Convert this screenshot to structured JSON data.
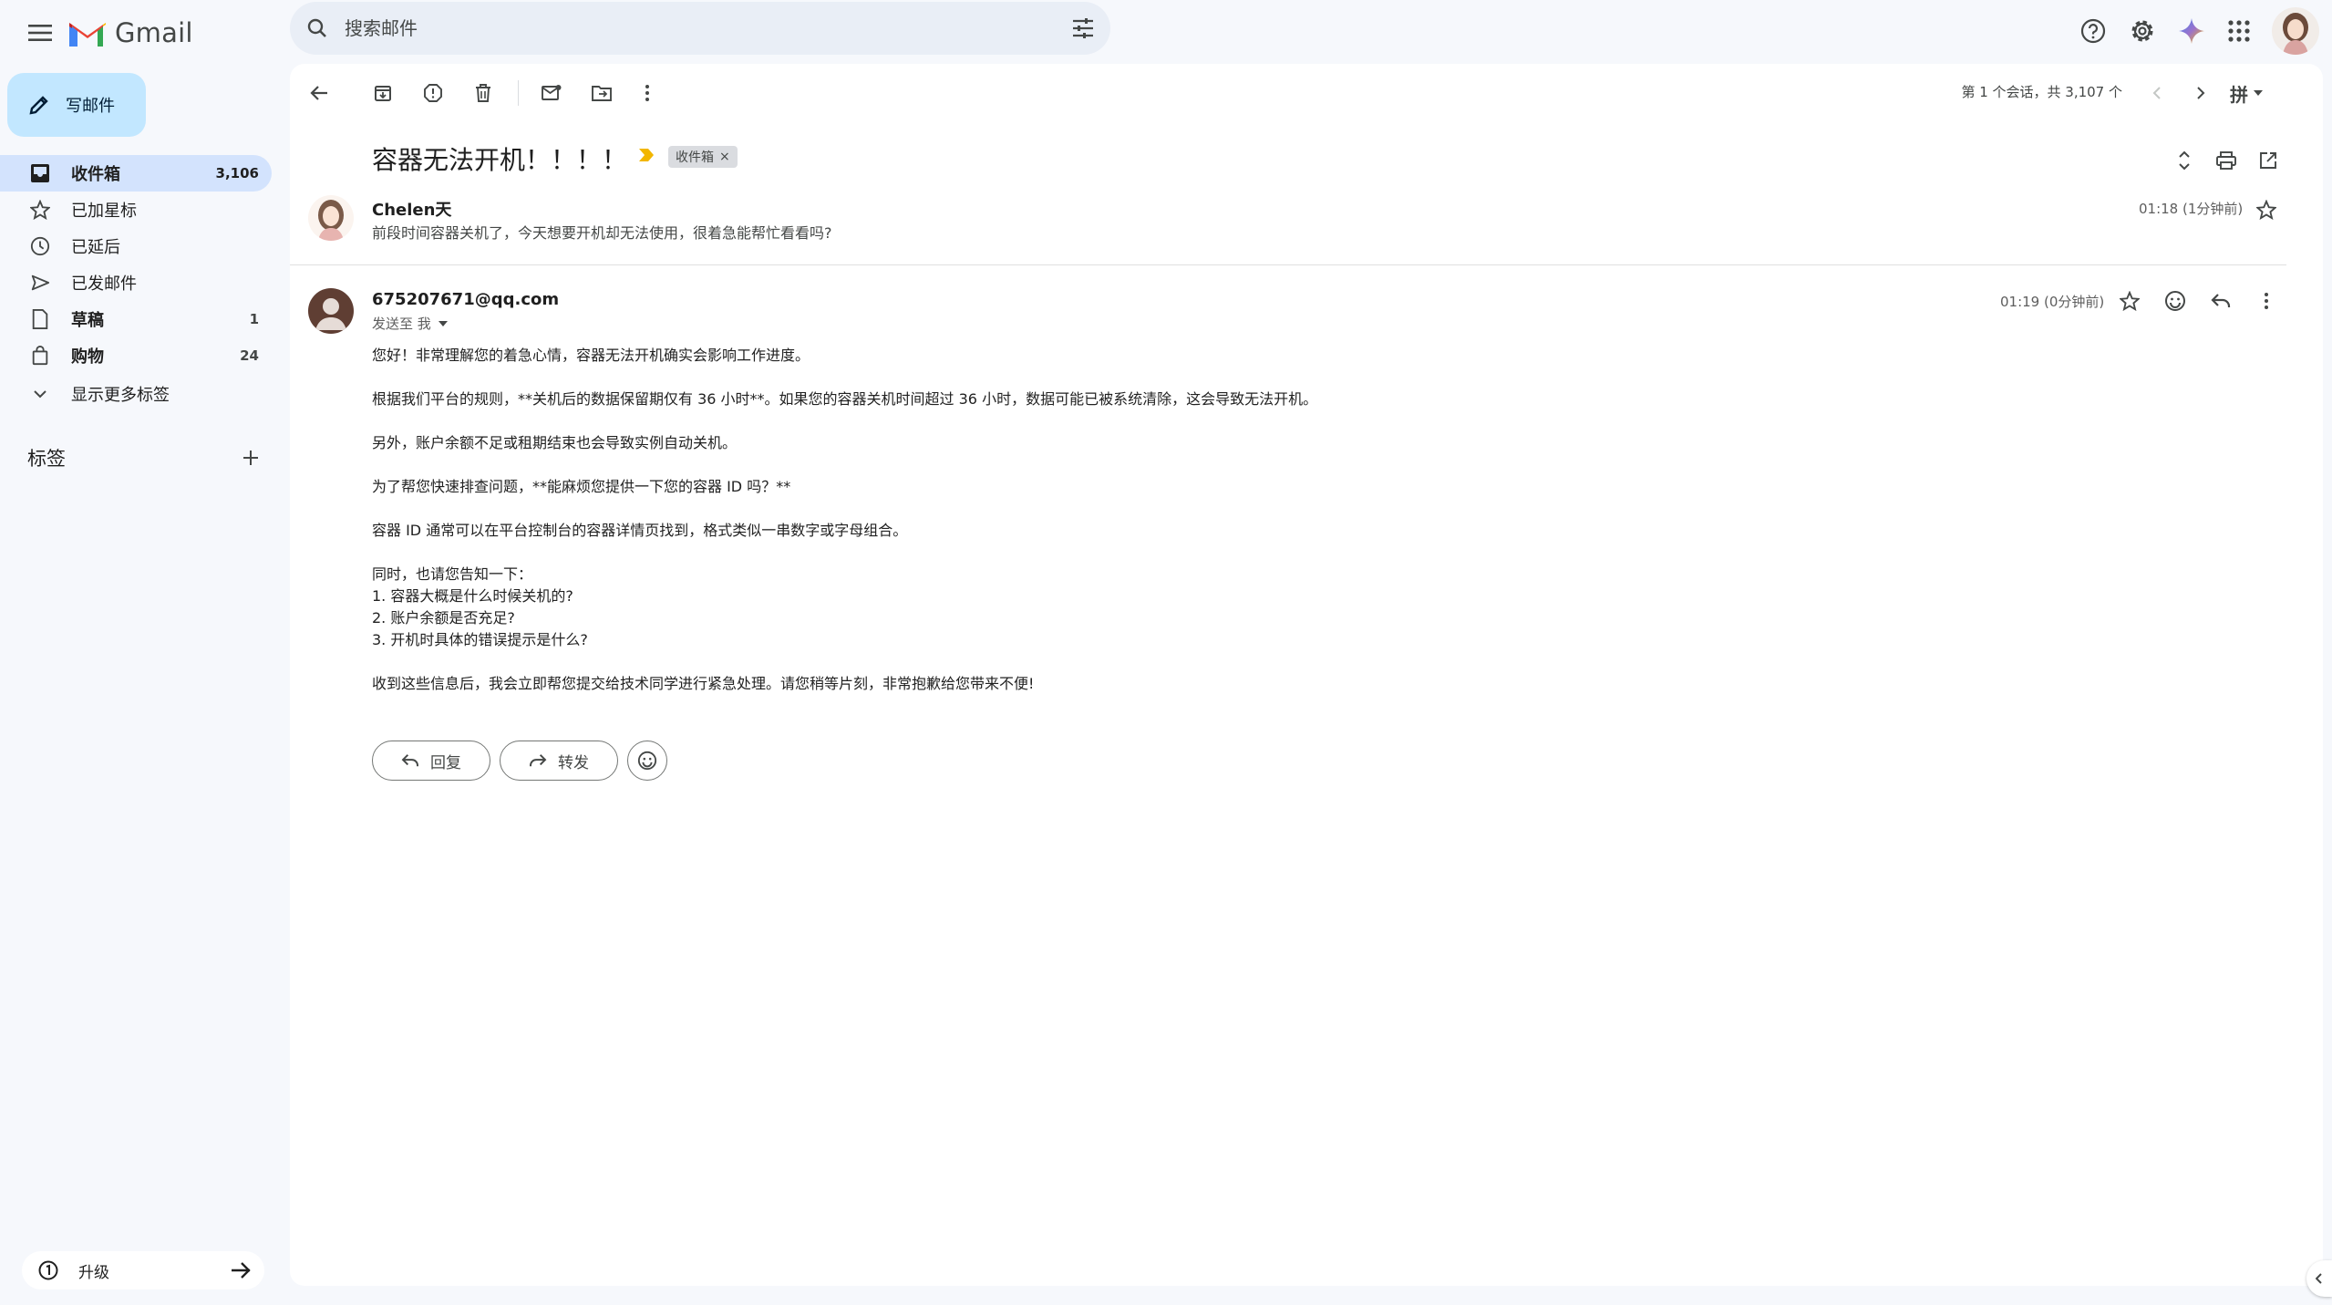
{
  "app": {
    "name": "Gmail"
  },
  "search": {
    "placeholder": "搜索邮件"
  },
  "sidebar": {
    "compose_label": "写邮件",
    "items": [
      {
        "label": "收件箱",
        "count": "3,106"
      },
      {
        "label": "已加星标",
        "count": ""
      },
      {
        "label": "已延后",
        "count": ""
      },
      {
        "label": "已发邮件",
        "count": ""
      },
      {
        "label": "草稿",
        "count": "1"
      },
      {
        "label": "购物",
        "count": "24"
      },
      {
        "label": "显示更多标签",
        "count": ""
      }
    ],
    "labels_heading": "标签",
    "upgrade_label": "升级"
  },
  "toolbar": {
    "pager_text": "第 1 个会话，共 3,107 个"
  },
  "thread": {
    "subject": "容器无法开机！！！！",
    "tag": "收件箱",
    "collapsed_message": {
      "sender": "Chelen天",
      "snippet": "前段时间容器关机了，今天想要开机却无法使用，很着急能帮忙看看吗?",
      "time": "01:18 (1分钟前)"
    },
    "message": {
      "sender": "675207671@qq.com",
      "to_line": "发送至 我",
      "time": "01:19 (0分钟前)",
      "body": [
        "您好！非常理解您的着急心情，容器无法开机确实会影响工作进度。",
        "根据我们平台的规则，**关机后的数据保留期仅有 36 小时**。如果您的容器关机时间超过 36 小时，数据可能已被系统清除，这会导致无法开机。",
        "另外，账户余额不足或租期结束也会导致实例自动关机。",
        "为了帮您快速排查问题，**能麻烦您提供一下您的容器 ID 吗？**",
        "容器 ID 通常可以在平台控制台的容器详情页找到，格式类似一串数字或字母组合。",
        "同时，也请您告知一下：",
        "1. 容器大概是什么时候关机的?",
        "2. 账户余额是否充足?",
        "3. 开机时具体的错误提示是什么?",
        "收到这些信息后，我会立即帮您提交给技术同学进行紧急处理。请您稍等片刻，非常抱歉给您带来不便!"
      ]
    },
    "reply_label": "回复",
    "forward_label": "转发"
  },
  "colors": {
    "compose_bg": "#c2e7ff",
    "active_nav_bg": "#d3e3fd",
    "page_bg": "#f6f8fc"
  }
}
